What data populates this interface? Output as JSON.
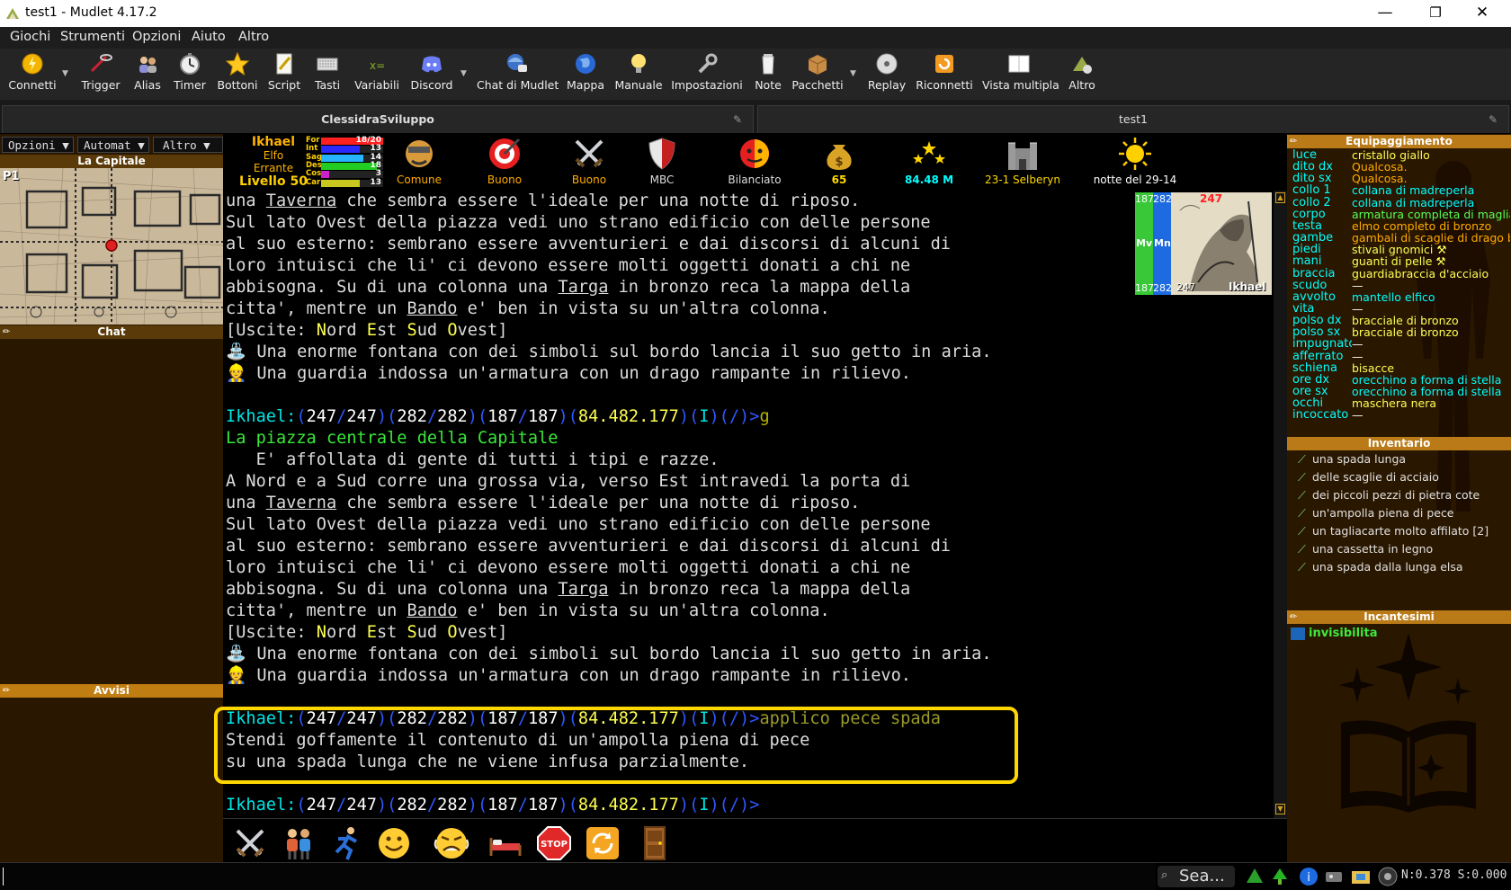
{
  "window": {
    "title": "test1 - Mudlet 4.17.2",
    "minimize": "—",
    "maximize": "❐",
    "close": "✕"
  },
  "menubar": [
    "Giochi",
    "Strumenti",
    "Opzioni",
    "Aiuto",
    "Altro"
  ],
  "toolbar": [
    {
      "label": "Connetti",
      "icon": "connect-icon"
    },
    {
      "label": "Trigger",
      "icon": "trigger-icon"
    },
    {
      "label": "Alias",
      "icon": "alias-icon"
    },
    {
      "label": "Timer",
      "icon": "timer-icon"
    },
    {
      "label": "Bottoni",
      "icon": "star-icon"
    },
    {
      "label": "Script",
      "icon": "script-icon"
    },
    {
      "label": "Tasti",
      "icon": "keyboard-icon"
    },
    {
      "label": "Variabili",
      "icon": "variables-icon"
    },
    {
      "label": "Discord",
      "icon": "discord-icon"
    },
    {
      "label": "Chat di Mudlet",
      "icon": "chat-icon"
    },
    {
      "label": "Mappa",
      "icon": "globe-icon"
    },
    {
      "label": "Manuale",
      "icon": "bulb-icon"
    },
    {
      "label": "Impostazioni",
      "icon": "wrench-icon"
    },
    {
      "label": "Note",
      "icon": "notes-icon"
    },
    {
      "label": "Pacchetti",
      "icon": "package-icon"
    },
    {
      "label": "Replay",
      "icon": "replay-icon"
    },
    {
      "label": "Riconnetti",
      "icon": "reconnect-icon"
    },
    {
      "label": "Vista multipla",
      "icon": "multiview-icon"
    },
    {
      "label": "Altro",
      "icon": "about-icon"
    }
  ],
  "tabs": [
    {
      "label": "ClessidraSviluppo"
    },
    {
      "label": "test1"
    }
  ],
  "left": {
    "dropdowns": [
      "Opzioni ▼",
      "Automat ▼",
      "Altro ▼"
    ],
    "map_title": "La Capitale",
    "map_layer": "P1",
    "chat_title": "Chat",
    "avvisi_title": "Avvisi"
  },
  "char": {
    "name": "Ikhael",
    "race": "Elfo",
    "class": "Errante",
    "level": "Livello 50"
  },
  "stats": [
    {
      "name": "For",
      "value": "18/20",
      "fill": 1.0,
      "color": "#ff2020"
    },
    {
      "name": "Int",
      "value": "13",
      "fill": 0.62,
      "color": "#2a2aff"
    },
    {
      "name": "Sag",
      "value": "14",
      "fill": 0.68,
      "color": "#26b3ff"
    },
    {
      "name": "Des",
      "value": "18",
      "fill": 0.9,
      "color": "#22cc22"
    },
    {
      "name": "Cos",
      "value": "3",
      "fill": 0.13,
      "color": "#cc22cc"
    },
    {
      "name": "Car",
      "value": "13",
      "fill": 0.62,
      "color": "#c8c820"
    }
  ],
  "status_icons": [
    {
      "label": "Comune",
      "icon": "face-icon",
      "color": "#ffaa00"
    },
    {
      "label": "Buono",
      "icon": "target-icon",
      "color": "#ffaa00"
    },
    {
      "label": "Buono",
      "icon": "swords-icon",
      "color": "#ffaa00"
    },
    {
      "label": "MBC",
      "icon": "shield-icon",
      "color": "#dddddd"
    },
    {
      "label": "Bilanciato",
      "icon": "mood-icon",
      "color": "#dddddd"
    },
    {
      "label": "65",
      "icon": "money-bag-icon",
      "color": "#ffd700"
    },
    {
      "label": "84.48 M",
      "icon": "stars-icon",
      "color": "#00ffff"
    },
    {
      "label": "23-1 Selberyn",
      "icon": "castle-icon",
      "color": "#ffd700"
    },
    {
      "label": "notte del 29-14",
      "icon": "sun-icon",
      "color": "#ffffff"
    }
  ],
  "vitals": {
    "mv": "187",
    "mn": "282",
    "hp": "247",
    "mv_label": "Mv",
    "mn_label": "Mn",
    "name": "Ikhael"
  },
  "console": [
    [
      {
        "t": "una "
      },
      {
        "t": "Taverna",
        "c": "ul"
      },
      {
        "t": " che sembra essere l'ideale per una notte di riposo."
      }
    ],
    [
      {
        "t": "Sul lato Ovest della piazza vedi uno strano edificio con delle persone"
      }
    ],
    [
      {
        "t": "al suo esterno: sembrano essere avventurieri e dai discorsi di alcuni di"
      }
    ],
    [
      {
        "t": "loro intuisci che li' ci devono essere molti oggetti donati a chi ne"
      }
    ],
    [
      {
        "t": "abbisogna. Su di una colonna una "
      },
      {
        "t": "Targa",
        "c": "ul"
      },
      {
        "t": " in bronzo reca la mappa della"
      }
    ],
    [
      {
        "t": "citta', mentre un "
      },
      {
        "t": "Bando",
        "c": "ul"
      },
      {
        "t": " e' ben in vista su un'altra colonna."
      }
    ],
    [
      {
        "t": "[Uscite: "
      },
      {
        "t": "N",
        "c": "yw"
      },
      {
        "t": "ord "
      },
      {
        "t": "E",
        "c": "yw"
      },
      {
        "t": "st "
      },
      {
        "t": "S",
        "c": "yw"
      },
      {
        "t": "ud "
      },
      {
        "t": "O",
        "c": "yw"
      },
      {
        "t": "vest]"
      }
    ],
    [
      {
        "t": "⛲",
        "c": "cy"
      },
      {
        "t": " Una enorme fontana con dei simboli sul bordo lancia il suo getto in aria."
      }
    ],
    [
      {
        "t": "👷",
        "c": "yw"
      },
      {
        "t": " Una guardia indossa un'armatura con un drago rampante in rilievo."
      }
    ],
    [
      {
        "t": ""
      }
    ],
    [
      {
        "t": "Ikhael:",
        "c": "cy"
      },
      {
        "t": "(",
        "c": "bl"
      },
      {
        "t": "247",
        "c": "wh"
      },
      {
        "t": "/",
        "c": "bl"
      },
      {
        "t": "247",
        "c": "wh"
      },
      {
        "t": ")(",
        "c": "bl"
      },
      {
        "t": "282",
        "c": "wh"
      },
      {
        "t": "/",
        "c": "bl"
      },
      {
        "t": "282",
        "c": "wh"
      },
      {
        "t": ")(",
        "c": "bl"
      },
      {
        "t": "187",
        "c": "wh"
      },
      {
        "t": "/",
        "c": "bl"
      },
      {
        "t": "187",
        "c": "wh"
      },
      {
        "t": ")(",
        "c": "bl"
      },
      {
        "t": "84.482.177",
        "c": "yw"
      },
      {
        "t": ")(",
        "c": "bl"
      },
      {
        "t": "I",
        "c": "cy"
      },
      {
        "t": ")(/)>",
        "c": "bl"
      },
      {
        "t": "g",
        "c": "ol"
      }
    ],
    [
      {
        "t": "La piazza centrale della Capitale",
        "c": "gr"
      }
    ],
    [
      {
        "t": "   E' affollata di gente di tutti i tipi e razze."
      }
    ],
    [
      {
        "t": "A Nord e a Sud corre una grossa via, verso Est intravedi la porta di"
      }
    ],
    [
      {
        "t": "una "
      },
      {
        "t": "Taverna",
        "c": "ul"
      },
      {
        "t": " che sembra essere l'ideale per una notte di riposo."
      }
    ],
    [
      {
        "t": "Sul lato Ovest della piazza vedi uno strano edificio con delle persone"
      }
    ],
    [
      {
        "t": "al suo esterno: sembrano essere avventurieri e dai discorsi di alcuni di"
      }
    ],
    [
      {
        "t": "loro intuisci che li' ci devono essere molti oggetti donati a chi ne"
      }
    ],
    [
      {
        "t": "abbisogna. Su di una colonna una "
      },
      {
        "t": "Targa",
        "c": "ul"
      },
      {
        "t": " in bronzo reca la mappa della"
      }
    ],
    [
      {
        "t": "citta', mentre un "
      },
      {
        "t": "Bando",
        "c": "ul"
      },
      {
        "t": " e' ben in vista su un'altra colonna."
      }
    ],
    [
      {
        "t": "[Uscite: "
      },
      {
        "t": "N",
        "c": "yw"
      },
      {
        "t": "ord "
      },
      {
        "t": "E",
        "c": "yw"
      },
      {
        "t": "st "
      },
      {
        "t": "S",
        "c": "yw"
      },
      {
        "t": "ud "
      },
      {
        "t": "O",
        "c": "yw"
      },
      {
        "t": "vest]"
      }
    ],
    [
      {
        "t": "⛲",
        "c": "cy"
      },
      {
        "t": " Una enorme fontana con dei simboli sul bordo lancia il suo getto in aria."
      }
    ],
    [
      {
        "t": "👷",
        "c": "yw"
      },
      {
        "t": " Una guardia indossa un'armatura con un drago rampante in rilievo."
      }
    ],
    [
      {
        "t": ""
      }
    ],
    [
      {
        "t": "Ikhael:",
        "c": "cy"
      },
      {
        "t": "(",
        "c": "bl"
      },
      {
        "t": "247",
        "c": "wh"
      },
      {
        "t": "/",
        "c": "bl"
      },
      {
        "t": "247",
        "c": "wh"
      },
      {
        "t": ")(",
        "c": "bl"
      },
      {
        "t": "282",
        "c": "wh"
      },
      {
        "t": "/",
        "c": "bl"
      },
      {
        "t": "282",
        "c": "wh"
      },
      {
        "t": ")(",
        "c": "bl"
      },
      {
        "t": "187",
        "c": "wh"
      },
      {
        "t": "/",
        "c": "bl"
      },
      {
        "t": "187",
        "c": "wh"
      },
      {
        "t": ")(",
        "c": "bl"
      },
      {
        "t": "84.482.177",
        "c": "yw"
      },
      {
        "t": ")(",
        "c": "bl"
      },
      {
        "t": "I",
        "c": "cy"
      },
      {
        "t": ")(/)>",
        "c": "bl"
      },
      {
        "t": "applico pece spada",
        "c": "gs"
      }
    ],
    [
      {
        "t": "Stendi goffamente il contenuto di un'ampolla piena di pece"
      }
    ],
    [
      {
        "t": "su una spada lunga che ne viene infusa parzialmente."
      }
    ],
    [
      {
        "t": ""
      }
    ],
    [
      {
        "t": "Ikhael:",
        "c": "cy"
      },
      {
        "t": "(",
        "c": "bl"
      },
      {
        "t": "247",
        "c": "wh"
      },
      {
        "t": "/",
        "c": "bl"
      },
      {
        "t": "247",
        "c": "wh"
      },
      {
        "t": ")(",
        "c": "bl"
      },
      {
        "t": "282",
        "c": "wh"
      },
      {
        "t": "/",
        "c": "bl"
      },
      {
        "t": "282",
        "c": "wh"
      },
      {
        "t": ")(",
        "c": "bl"
      },
      {
        "t": "187",
        "c": "wh"
      },
      {
        "t": "/",
        "c": "bl"
      },
      {
        "t": "187",
        "c": "wh"
      },
      {
        "t": ")(",
        "c": "bl"
      },
      {
        "t": "84.482.177",
        "c": "yw"
      },
      {
        "t": ")(",
        "c": "bl"
      },
      {
        "t": "I",
        "c": "cy"
      },
      {
        "t": ")(/)>",
        "c": "bl"
      }
    ]
  ],
  "actions": [
    {
      "icon": "crossed-swords-icon"
    },
    {
      "icon": "group-icon"
    },
    {
      "icon": "running-icon"
    },
    {
      "icon": "smiley-icon"
    },
    {
      "icon": "angry-face-icon"
    },
    {
      "icon": "bed-icon"
    },
    {
      "icon": "stop-sign-icon",
      "label": "STOP"
    },
    {
      "icon": "refresh-icon"
    },
    {
      "icon": "door-icon"
    }
  ],
  "equipment": {
    "title": "Equipaggiamento",
    "items": [
      {
        "slot": "luce",
        "item": "cristallo giallo",
        "color": "#ffff55"
      },
      {
        "slot": "dito dx",
        "item": "Qualcosa.",
        "color": "#ffaa00"
      },
      {
        "slot": "dito sx",
        "item": "Qualcosa.",
        "color": "#ffaa00"
      },
      {
        "slot": "collo 1",
        "item": "collana di madreperla",
        "color": "#00ffff"
      },
      {
        "slot": "collo 2",
        "item": "collana di madreperla",
        "color": "#00ffff"
      },
      {
        "slot": "corpo",
        "item": "armatura completa di maglia",
        "color": "#55ff55"
      },
      {
        "slot": "testa",
        "item": "elmo completo di bronzo",
        "color": "#ffaa00"
      },
      {
        "slot": "gambe",
        "item": "gambali di scaglie di drago b",
        "color": "#ffaa00"
      },
      {
        "slot": "piedi",
        "item": "stivali gnomici ⚒",
        "color": "#ffff55"
      },
      {
        "slot": "mani",
        "item": "guanti di pelle ⚒",
        "color": "#ffff55"
      },
      {
        "slot": "braccia",
        "item": "guardiabraccia d'acciaio",
        "color": "#ffff55"
      },
      {
        "slot": "scudo",
        "item": "—",
        "color": "#ffffff"
      },
      {
        "slot": "avvolto",
        "item": "mantello elfico",
        "color": "#00ffff"
      },
      {
        "slot": "vita",
        "item": "—",
        "color": "#ffffff"
      },
      {
        "slot": "polso dx",
        "item": "bracciale di bronzo",
        "color": "#ffff55"
      },
      {
        "slot": "polso sx",
        "item": "bracciale di bronzo",
        "color": "#ffff55"
      },
      {
        "slot": "impugnato",
        "item": "—",
        "color": "#ffffff"
      },
      {
        "slot": "afferrato",
        "item": "—",
        "color": "#ffffff"
      },
      {
        "slot": "schiena",
        "item": "bisacce",
        "color": "#ffff55"
      },
      {
        "slot": "ore dx",
        "item": "orecchino a forma di stella",
        "color": "#00ffff"
      },
      {
        "slot": "ore sx",
        "item": "orecchino a forma di stella",
        "color": "#00ffff"
      },
      {
        "slot": "occhi",
        "item": "maschera nera",
        "color": "#ffff55"
      },
      {
        "slot": "incoccato",
        "item": "—",
        "color": "#ffffff"
      }
    ]
  },
  "inventory": {
    "title": "Inventario",
    "items": [
      "una spada lunga",
      "delle scaglie di acciaio",
      "dei piccoli pezzi di pietra cote",
      "un'ampolla piena di pece",
      "un tagliacarte molto affilato [2]",
      "una cassetta in legno",
      "una spada dalla lunga elsa"
    ]
  },
  "spells": {
    "title": "Incantesimi",
    "items": [
      "invisibilita"
    ]
  },
  "taskbar": {
    "search": "Sea...",
    "stats": "N:0.378 S:0.000"
  },
  "colors": {
    "accent": "#b97a17",
    "panel_bg": "#2a1700",
    "highlight": "#ffd700"
  }
}
